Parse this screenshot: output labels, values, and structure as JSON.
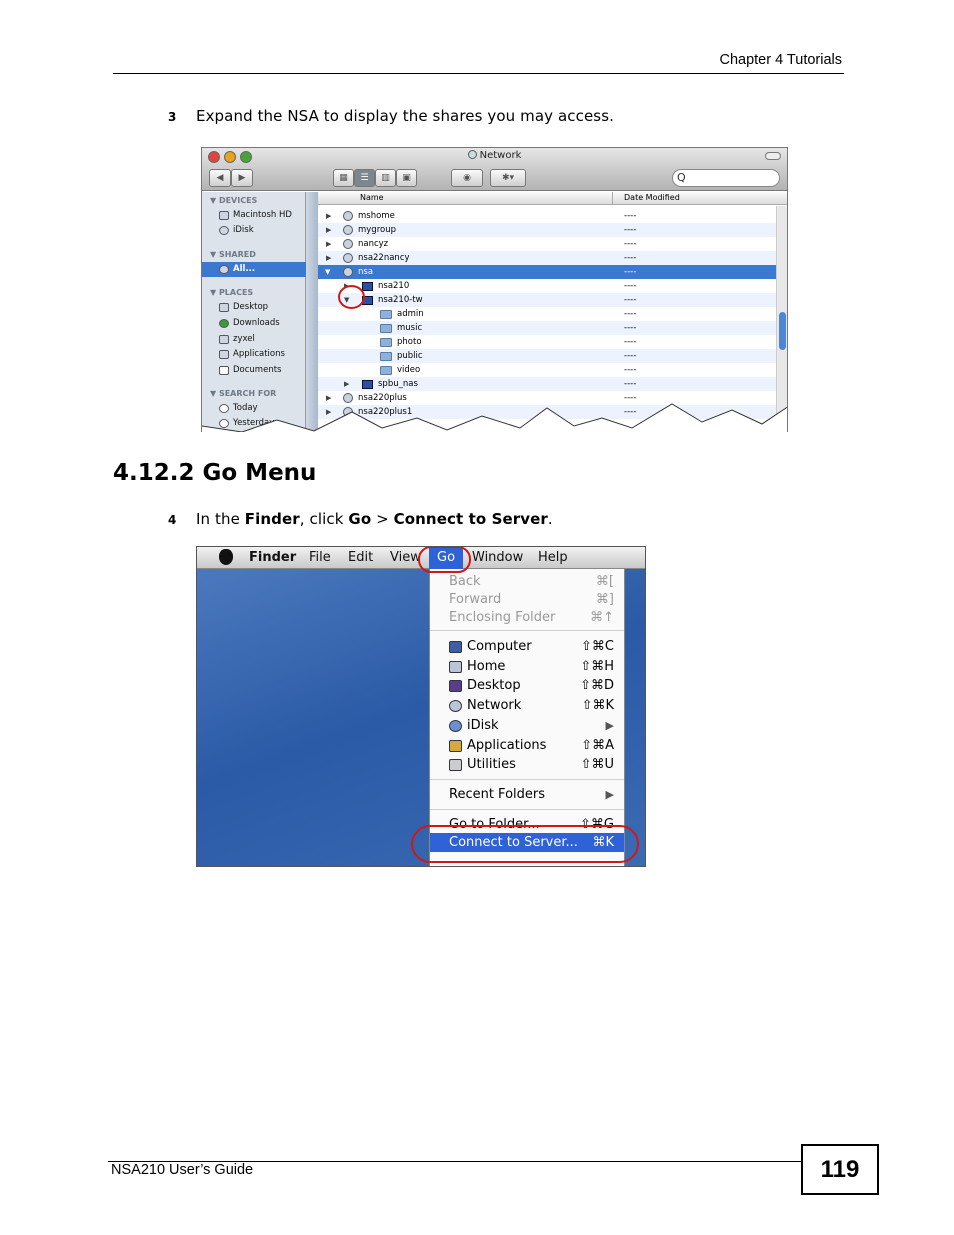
{
  "header": {
    "chapter": "Chapter 4 Tutorials"
  },
  "step3": {
    "number": "3",
    "text": "Expand the NSA to display the shares you may access."
  },
  "section": {
    "title": "4.12.2  Go Menu"
  },
  "step4": {
    "number": "4",
    "pre": "In the ",
    "finder": "Finder",
    "mid": ", click ",
    "go": "Go",
    "gt": " > ",
    "connect": "Connect to Server",
    "post": "."
  },
  "finder_window": {
    "title": "Network",
    "search_placeholder": "Q",
    "nav_back": "◀",
    "nav_forward": "▶",
    "columns": {
      "name": "Name",
      "date": "Date Modified"
    },
    "sidebar": {
      "devices_head": "▼ DEVICES",
      "devices": [
        "Macintosh HD",
        "iDisk"
      ],
      "shared_head": "▼ SHARED",
      "shared": [
        "All..."
      ],
      "places_head": "▼ PLACES",
      "places": [
        "Desktop",
        "Downloads",
        "zyxel",
        "Applications",
        "Documents"
      ],
      "search_head": "▼ SEARCH FOR",
      "search": [
        "Today",
        "Yesterday"
      ]
    },
    "rows": [
      {
        "name": "mshome",
        "date": "----"
      },
      {
        "name": "mygroup",
        "date": "----"
      },
      {
        "name": "nancyz",
        "date": "----"
      },
      {
        "name": "nsa22nancy",
        "date": "----"
      },
      {
        "name": "nsa",
        "date": "----"
      },
      {
        "name": "nsa210",
        "date": "----"
      },
      {
        "name": "nsa210-tw",
        "date": "----"
      },
      {
        "name": "admin",
        "date": "----"
      },
      {
        "name": "music",
        "date": "----"
      },
      {
        "name": "photo",
        "date": "----"
      },
      {
        "name": "public",
        "date": "----"
      },
      {
        "name": "video",
        "date": "----"
      },
      {
        "name": "spbu_nas",
        "date": "----"
      },
      {
        "name": "nsa220plus",
        "date": "----"
      },
      {
        "name": "nsa220plus1",
        "date": "----"
      }
    ]
  },
  "go_menu": {
    "menubar": [
      "Finder",
      "File",
      "Edit",
      "View",
      "Go",
      "Window",
      "Help"
    ],
    "items": [
      {
        "label": "Back",
        "key": "⌘[",
        "disabled": true
      },
      {
        "label": "Forward",
        "key": "⌘]",
        "disabled": true
      },
      {
        "label": "Enclosing Folder",
        "key": "⌘↑",
        "disabled": true
      },
      {
        "label": "Computer",
        "key": "⇧⌘C",
        "icon": "computer-icon"
      },
      {
        "label": "Home",
        "key": "⇧⌘H",
        "icon": "home-icon"
      },
      {
        "label": "Desktop",
        "key": "⇧⌘D",
        "icon": "desktop-icon"
      },
      {
        "label": "Network",
        "key": "⇧⌘K",
        "icon": "network-icon"
      },
      {
        "label": "iDisk",
        "key": "▶",
        "icon": "idisk-icon"
      },
      {
        "label": "Applications",
        "key": "⇧⌘A",
        "icon": "applications-icon"
      },
      {
        "label": "Utilities",
        "key": "⇧⌘U",
        "icon": "utilities-icon"
      },
      {
        "label": "Recent Folders",
        "key": "▶"
      },
      {
        "label": "Go to Folder...",
        "key": "⇧⌘G"
      },
      {
        "label": "Connect to Server...",
        "key": "⌘K"
      }
    ]
  },
  "footer": {
    "guide": "NSA210 User’s Guide",
    "page": "119"
  }
}
